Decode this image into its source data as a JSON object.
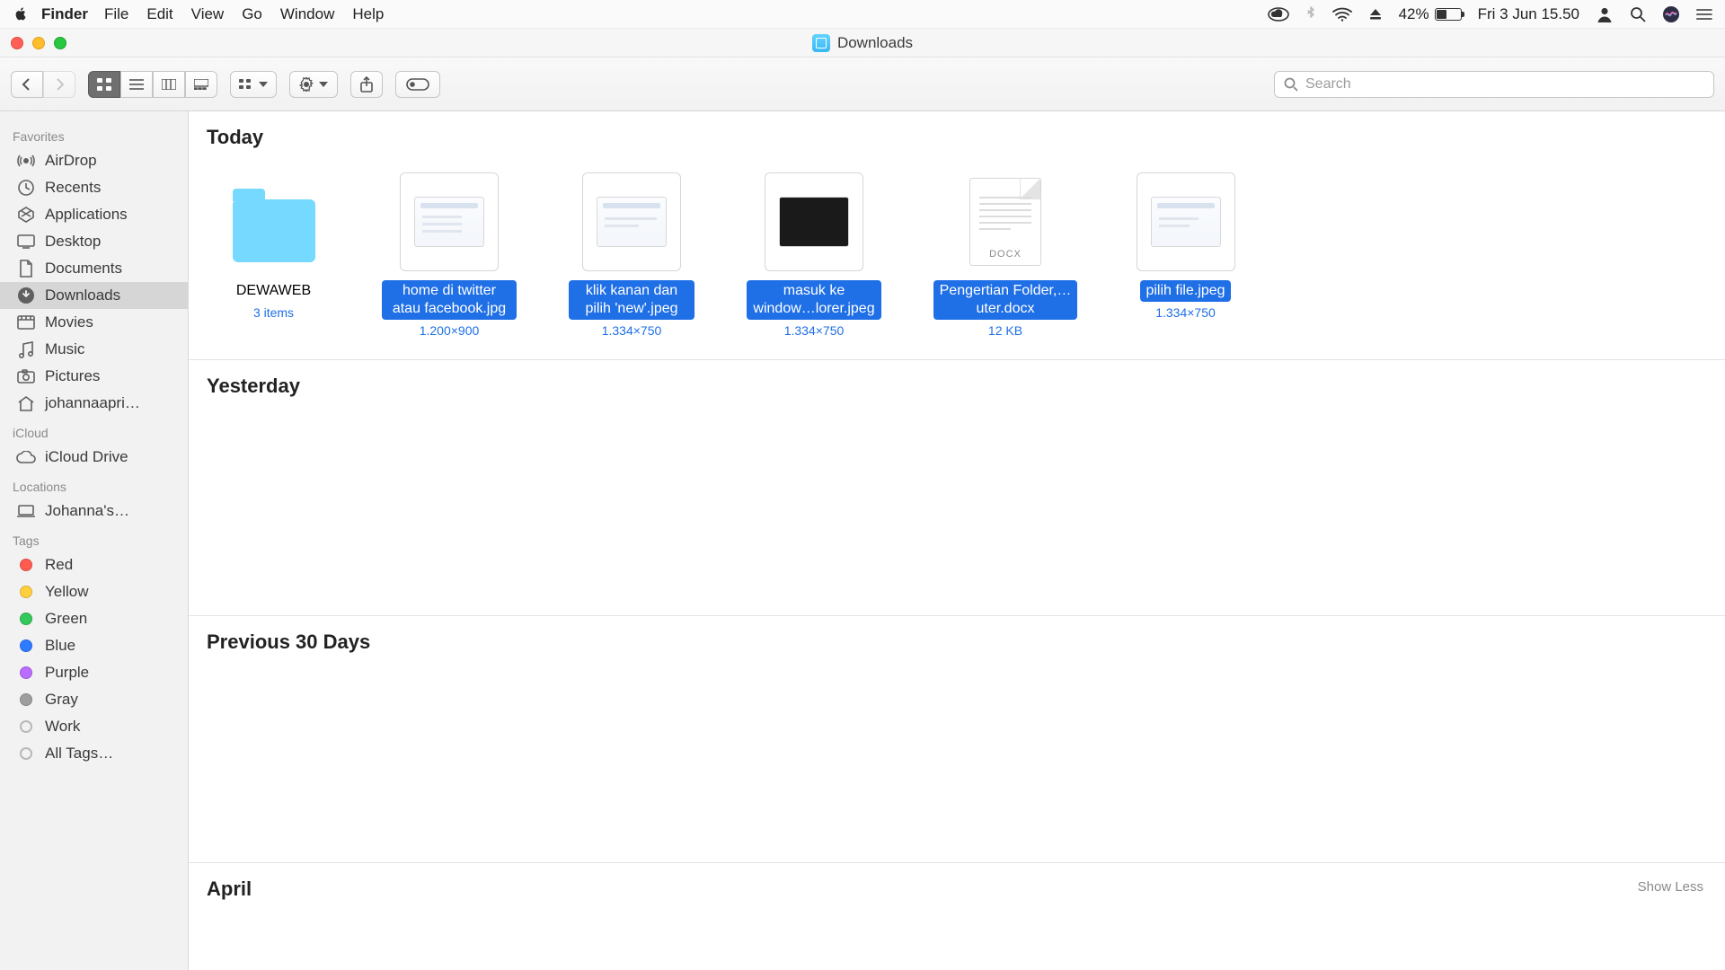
{
  "menubar": {
    "app_name": "Finder",
    "items": [
      "File",
      "Edit",
      "View",
      "Go",
      "Window",
      "Help"
    ],
    "battery_pct": "42%",
    "datetime": "Fri 3 Jun  15.50"
  },
  "window": {
    "title": "Downloads",
    "search_placeholder": "Search"
  },
  "sidebar": {
    "favorites_label": "Favorites",
    "favorites": [
      {
        "label": "AirDrop"
      },
      {
        "label": "Recents"
      },
      {
        "label": "Applications"
      },
      {
        "label": "Desktop"
      },
      {
        "label": "Documents"
      },
      {
        "label": "Downloads",
        "selected": true
      },
      {
        "label": "Movies"
      },
      {
        "label": "Music"
      },
      {
        "label": "Pictures"
      },
      {
        "label": "johannaapri…"
      }
    ],
    "icloud_label": "iCloud",
    "icloud": [
      {
        "label": "iCloud Drive"
      }
    ],
    "locations_label": "Locations",
    "locations": [
      {
        "label": "Johanna's…"
      }
    ],
    "tags_label": "Tags",
    "tags": [
      {
        "label": "Red",
        "color": "#ff5b4f"
      },
      {
        "label": "Yellow",
        "color": "#ffcf3d"
      },
      {
        "label": "Green",
        "color": "#34c759"
      },
      {
        "label": "Blue",
        "color": "#2e7bff"
      },
      {
        "label": "Purple",
        "color": "#b96cff"
      },
      {
        "label": "Gray",
        "color": "#9e9e9e"
      },
      {
        "label": "Work",
        "outline": true
      },
      {
        "label": "All Tags…",
        "outline": true
      }
    ]
  },
  "sections": {
    "today": "Today",
    "yesterday": "Yesterday",
    "previous30": "Previous 30 Days",
    "april": "April",
    "show_less": "Show Less"
  },
  "files_today": [
    {
      "kind": "folder",
      "name": "DEWAWEB",
      "meta": "3 items",
      "selected": false,
      "meta_sel": true
    },
    {
      "kind": "image",
      "name": "home di twitter atau facebook.jpg",
      "meta": "1.200×900",
      "selected": true
    },
    {
      "kind": "image",
      "name": "klik kanan dan pilih 'new'.jpeg",
      "meta": "1.334×750",
      "selected": true
    },
    {
      "kind": "image",
      "name": "masuk ke window…lorer.jpeg",
      "meta": "1.334×750",
      "selected": true,
      "dark": true
    },
    {
      "kind": "docx",
      "name": "Pengertian Folder,…uter.docx",
      "meta": "12 KB",
      "selected": true,
      "docx_badge": "DOCX"
    },
    {
      "kind": "image",
      "name": "pilih file.jpeg",
      "meta": "1.334×750",
      "selected": true
    }
  ]
}
